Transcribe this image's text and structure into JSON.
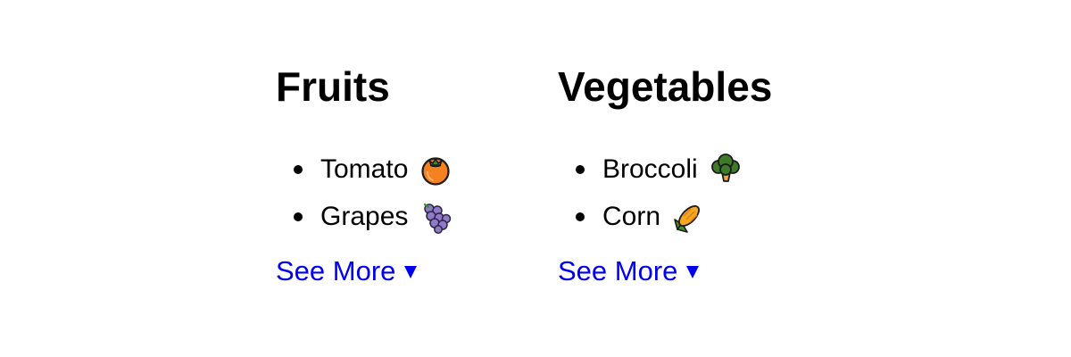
{
  "colors": {
    "text": "#000000",
    "link": "#0000ee",
    "background": "#ffffff"
  },
  "fruits": {
    "title": "Fruits",
    "items": [
      {
        "label": "Tomato",
        "icon": "tomato-icon"
      },
      {
        "label": "Grapes",
        "icon": "grapes-icon"
      }
    ],
    "see_more": "See More"
  },
  "vegetables": {
    "title": "Vegetables",
    "items": [
      {
        "label": "Broccoli",
        "icon": "broccoli-icon"
      },
      {
        "label": "Corn",
        "icon": "corn-icon"
      }
    ],
    "see_more": "See More"
  }
}
